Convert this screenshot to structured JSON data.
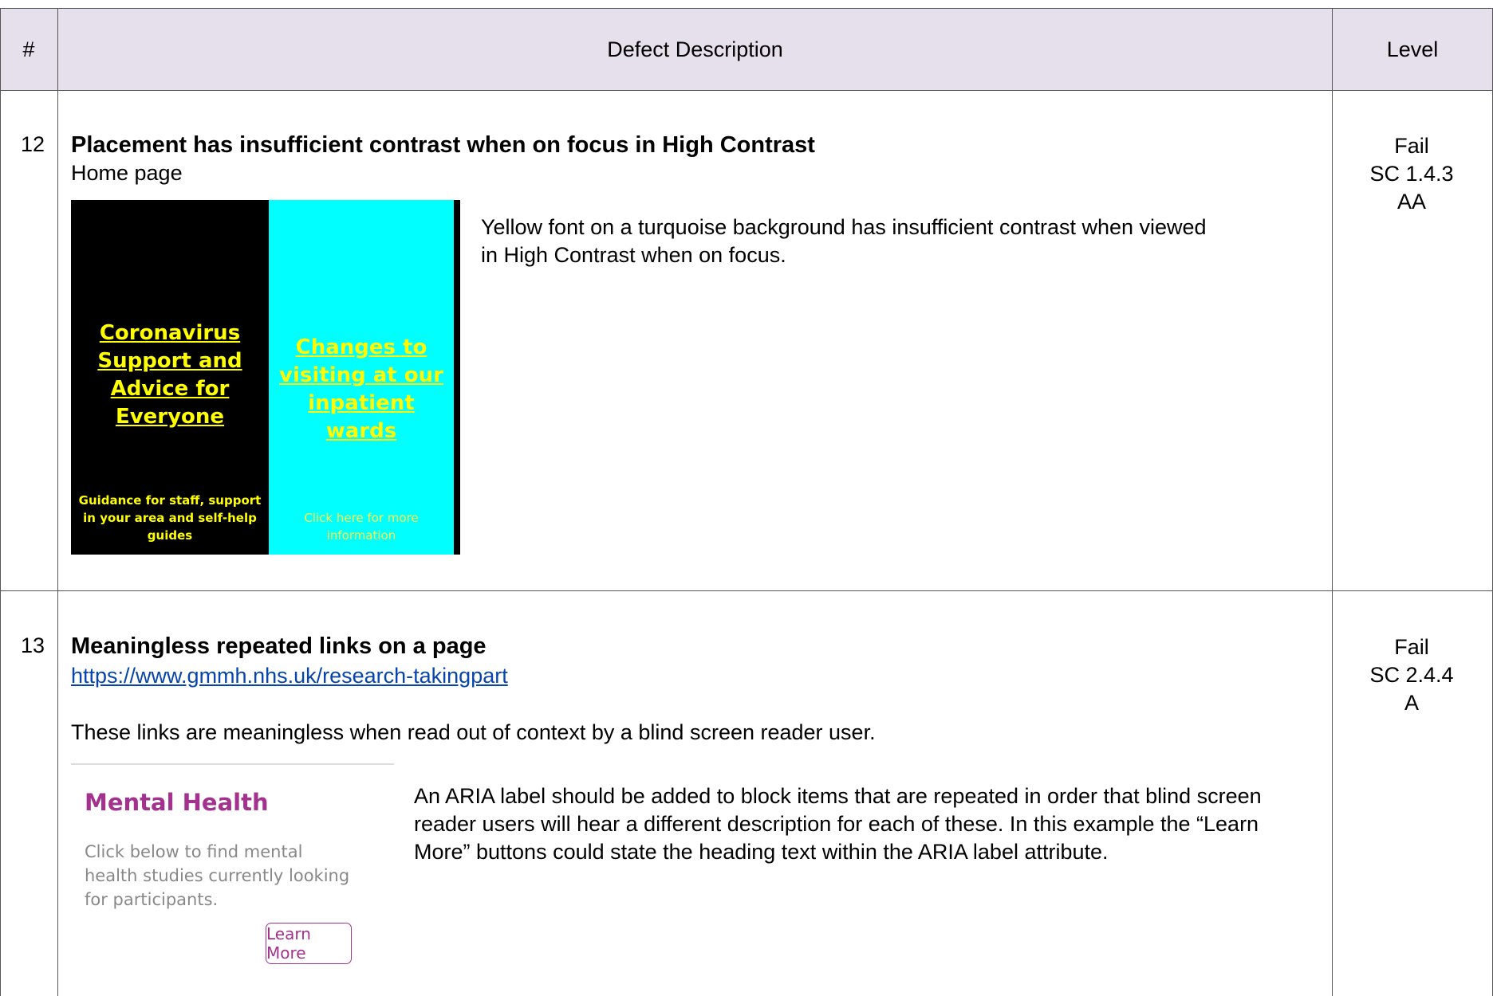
{
  "header": {
    "num": "#",
    "description": "Defect Description",
    "level": "Level"
  },
  "defects": [
    {
      "num": "12",
      "title": "Placement has insufficient contrast when on focus in High Contrast",
      "location": "Home page",
      "description": "Yellow font on a turquoise background has insufficient contrast when viewed in High Contrast when on focus.",
      "level": {
        "result": "Fail",
        "criterion": "SC 1.4.3",
        "grade": "AA"
      },
      "screenshot": {
        "panel1_heading": "Coronavirus Support and Advice for Everyone",
        "panel1_caption": "Guidance for staff, support in your area and self-help guides",
        "panel2_heading": "Changes to visiting at our inpatient wards",
        "panel2_caption": "Click here for more information"
      }
    },
    {
      "num": "13",
      "title": "Meaningless repeated links on a page",
      "location": "https://www.gmmh.nhs.uk/research-takingpart",
      "intro": "These links are meaningless when read out of context by a blind screen reader user.",
      "description": "An ARIA label should be added to block items that are repeated in order that blind screen reader users will hear a different description for each of these. In this example the “Learn More” buttons could state the heading text within the ARIA label attribute.",
      "level": {
        "result": "Fail",
        "criterion": "SC 2.4.4",
        "grade": "A"
      },
      "screenshot": {
        "heading": "Mental Health",
        "text": "Click below to find mental health studies currently looking for participants.",
        "button": "Learn More"
      }
    }
  ]
}
